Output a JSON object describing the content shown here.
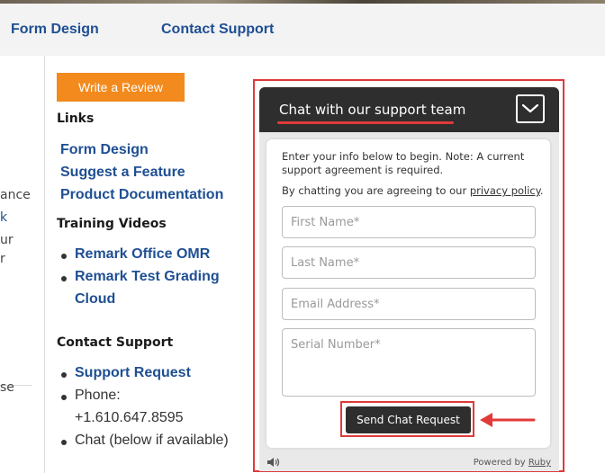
{
  "topnav": {
    "items": [
      {
        "label": "Form Design"
      },
      {
        "label": "Contact Support"
      }
    ]
  },
  "left_fragments": [
    "ance",
    "k",
    "ur",
    "r",
    "se"
  ],
  "sidebar": {
    "review_button": "Write a Review",
    "links_heading": "Links",
    "links": [
      {
        "label": "Form Design"
      },
      {
        "label": "Suggest a Feature"
      },
      {
        "label": "Product Documentation"
      }
    ],
    "training_heading": "Training Videos",
    "training": [
      {
        "label": "Remark Office OMR"
      },
      {
        "label": "Remark Test Grading"
      },
      {
        "label": "Cloud"
      }
    ],
    "contact_heading": "Contact Support",
    "contact": {
      "support_request": "Support Request",
      "phone_label": "Phone:",
      "phone_number": "+1.610.647.8595",
      "chat": "Chat (below if available)"
    }
  },
  "chat": {
    "title": "Chat with our support team",
    "intro": "Enter your info below to begin. Note: A current support agreement is required.",
    "consent_prefix": "By chatting you are agreeing to our ",
    "privacy_link": "privacy policy",
    "consent_suffix": ".",
    "fields": {
      "first_name": "First Name*",
      "last_name": "Last Name*",
      "email": "Email Address*",
      "serial": "Serial Number*"
    },
    "send_button": "Send Chat Request",
    "powered_prefix": "Powered by ",
    "powered_brand": "Ruby"
  },
  "colors": {
    "brand_blue": "#1f4f93",
    "accent_orange": "#f28a1e",
    "highlight_red": "#e03a3a",
    "chat_dark": "#2e2e2e"
  },
  "icons": {
    "toggle": "chevron-down-icon",
    "sound": "speaker-icon",
    "annotation": "arrow-left-icon"
  }
}
